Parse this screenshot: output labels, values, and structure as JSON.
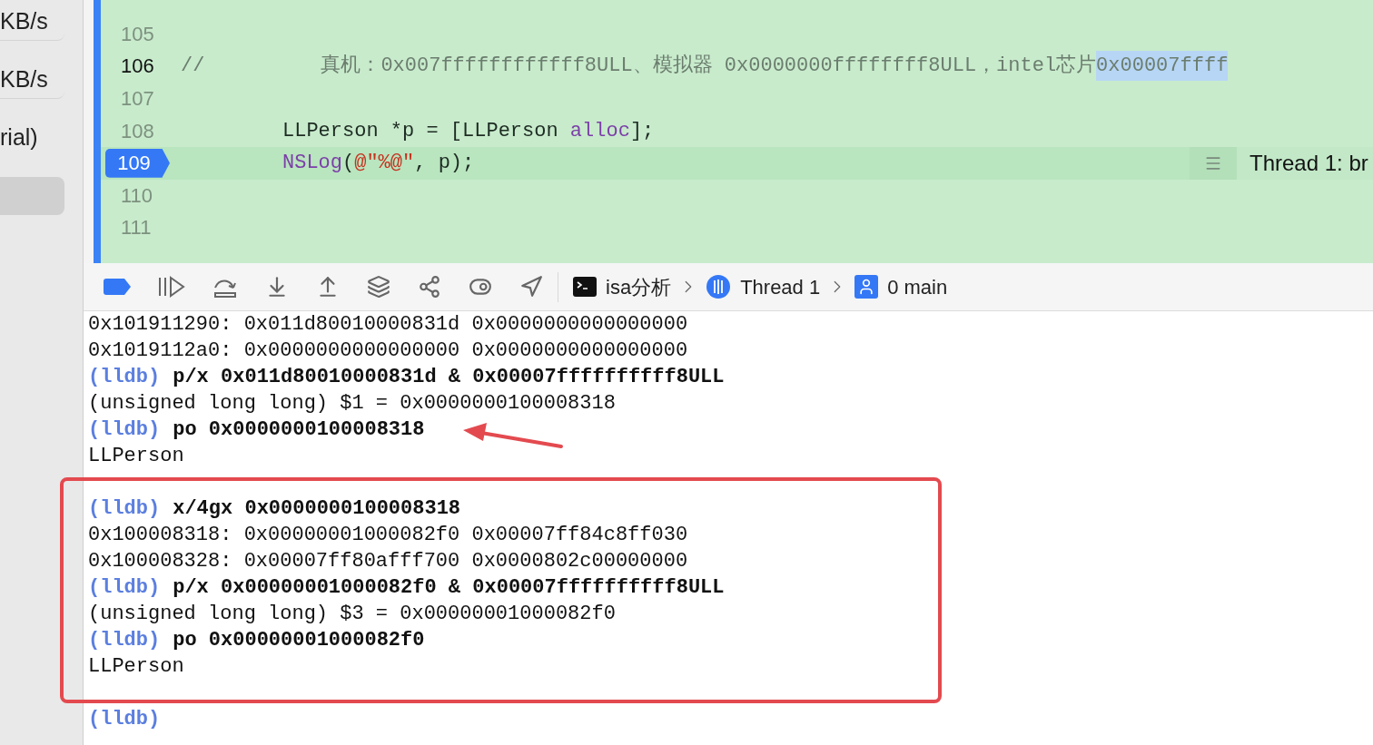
{
  "sidebar": {
    "items": [
      {
        "label": "KB/s",
        "selected": false
      },
      {
        "label": "KB/s",
        "selected": false
      },
      {
        "label": "rial)",
        "selected": false
      },
      {
        "selected": true
      }
    ]
  },
  "editor": {
    "lines": [
      {
        "number": "105",
        "current": false,
        "cursor": false
      },
      {
        "number": "106",
        "current": false,
        "cursor": true,
        "code": [
          {
            "kind": "comment",
            "text": "//"
          },
          {
            "kind": "comment",
            "text": "真机：0x007ffffffffffff8ULL、模拟器 0x0000000ffffffff8ULL，intel芯片"
          },
          {
            "kind": "selection",
            "text": "0x00007ffff"
          }
        ]
      },
      {
        "number": "107",
        "current": false,
        "cursor": false
      },
      {
        "number": "108",
        "current": false,
        "cursor": false,
        "code": [
          {
            "kind": "plain",
            "text": "LLPerson *p = [LLPerson "
          },
          {
            "kind": "keyword",
            "text": "alloc"
          },
          {
            "kind": "plain",
            "text": "];"
          }
        ]
      },
      {
        "number": "109",
        "current": true,
        "cursor": false,
        "code": [
          {
            "kind": "keyword",
            "text": "NSLog"
          },
          {
            "kind": "plain",
            "text": "("
          },
          {
            "kind": "string",
            "text": "@\"%@\""
          },
          {
            "kind": "plain",
            "text": ", p);"
          }
        ],
        "annotation": "Thread 1: br"
      },
      {
        "number": "110",
        "current": false,
        "cursor": false
      },
      {
        "number": "111",
        "current": false,
        "cursor": false
      }
    ]
  },
  "debug_bar": {
    "breakpoints_active": true,
    "breadcrumbs": [
      {
        "kind": "process",
        "label": "isa分析"
      },
      {
        "kind": "thread",
        "label": "Thread 1"
      },
      {
        "kind": "frame",
        "label": "0 main"
      }
    ]
  },
  "console": {
    "lines": [
      {
        "kind": "output",
        "text": "0x101911290: 0x011d80010000831d 0x0000000000000000"
      },
      {
        "kind": "output",
        "text": "0x1019112a0: 0x0000000000000000 0x0000000000000000"
      },
      {
        "kind": "prompt",
        "prompt": "(lldb)",
        "command": "p/x 0x011d80010000831d & 0x00007ffffffffff8ULL"
      },
      {
        "kind": "output",
        "text": "(unsigned long long) $1 = 0x0000000100008318"
      },
      {
        "kind": "prompt",
        "prompt": "(lldb)",
        "command": "po 0x0000000100008318"
      },
      {
        "kind": "output",
        "text": "LLPerson"
      },
      {
        "kind": "blank"
      },
      {
        "kind": "prompt",
        "prompt": "(lldb)",
        "command": "x/4gx 0x0000000100008318"
      },
      {
        "kind": "output",
        "text": "0x100008318: 0x00000001000082f0 0x00007ff84c8ff030"
      },
      {
        "kind": "output",
        "text": "0x100008328: 0x00007ff80afff700 0x0000802c00000000"
      },
      {
        "kind": "prompt",
        "prompt": "(lldb)",
        "command": "p/x 0x00000001000082f0 & 0x00007ffffffffff8ULL"
      },
      {
        "kind": "output",
        "text": "(unsigned long long) $3 = 0x00000001000082f0"
      },
      {
        "kind": "prompt",
        "prompt": "(lldb)",
        "command": "po 0x00000001000082f0"
      },
      {
        "kind": "output",
        "text": "LLPerson"
      },
      {
        "kind": "blank"
      },
      {
        "kind": "prompt",
        "prompt": "(lldb)"
      }
    ]
  }
}
